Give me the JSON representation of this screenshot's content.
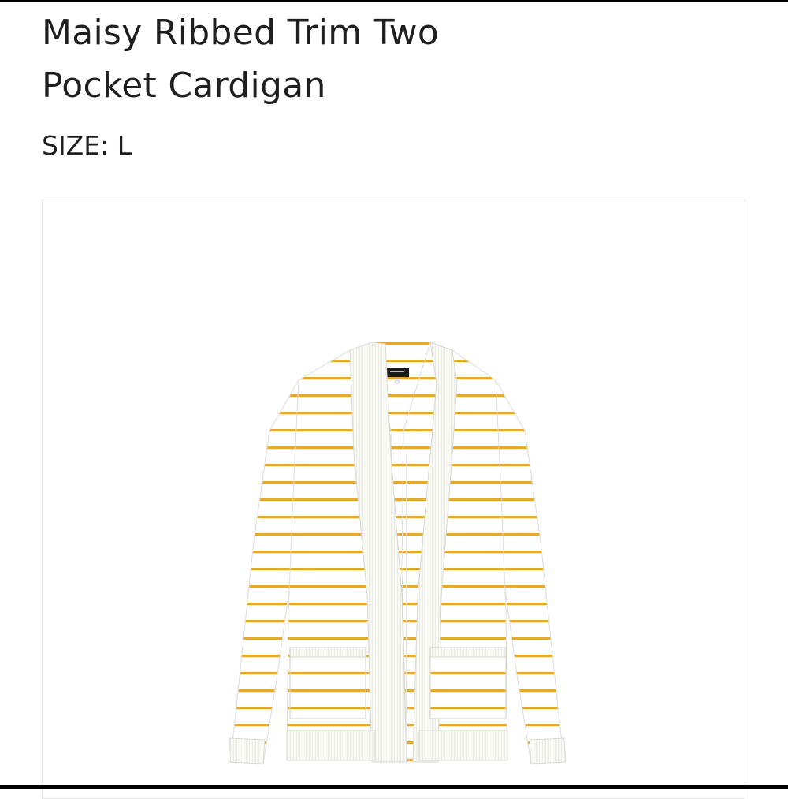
{
  "product": {
    "title_line1": "Maisy Ribbed Trim Two",
    "title_line2": "Pocket Cardigan",
    "size_text": "SIZE: L",
    "image_alt": "Maisy Ribbed Trim Two Pocket Cardigan",
    "colors": {
      "body": "#ffffff",
      "stripe": "#e6a92e",
      "trim": "#f6f6f2",
      "shadow": "#d9d9d4"
    }
  }
}
